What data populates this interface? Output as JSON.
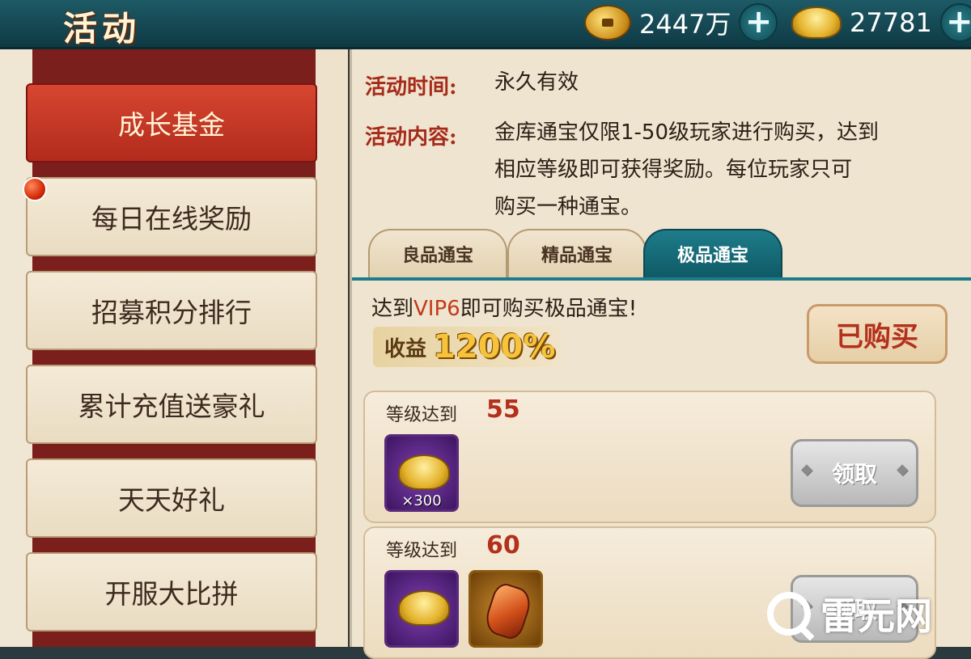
{
  "header": {
    "title": "活动",
    "copper": {
      "value": "2447万",
      "icon": "copper-coin-icon"
    },
    "gold": {
      "value": "27781",
      "icon": "gold-ingot-icon"
    }
  },
  "sidebar": {
    "items": [
      {
        "label": "成长基金",
        "active": true
      },
      {
        "label": "每日在线奖励",
        "notify": true
      },
      {
        "label": "招募积分排行"
      },
      {
        "label": "累计充值送豪礼"
      },
      {
        "label": "天天好礼"
      },
      {
        "label": "开服大比拼"
      }
    ]
  },
  "panel": {
    "time_label": "活动时间:",
    "time_value": "永久有效",
    "content_label": "活动内容:",
    "content_lines": [
      "金库通宝仅限1-50级玩家进行购买，达到",
      "相应等级即可获得奖励。每位玩家只可",
      "购买一种通宝。"
    ],
    "tabs": [
      "良品通宝",
      "精品通宝",
      "极品通宝"
    ],
    "active_tab": 2,
    "requirement_prefix": "达到",
    "requirement_vip": "VIP6",
    "requirement_suffix": "即可购买极品通宝!",
    "yield_label": "收益",
    "yield_value": "1200%",
    "bought_label": "已购买",
    "rewards": [
      {
        "level_label": "等级达到",
        "level": "55",
        "items": [
          {
            "icon": "gold-ingot-icon",
            "qty": "×300"
          }
        ],
        "claim_label": "领取"
      },
      {
        "level_label": "等级达到",
        "level": "60",
        "items": [
          {
            "icon": "gold-ingot-icon",
            "qty": ""
          },
          {
            "icon": "gem-icon",
            "qty": ""
          }
        ],
        "claim_label": "领取"
      }
    ]
  },
  "watermark": "雷元网"
}
